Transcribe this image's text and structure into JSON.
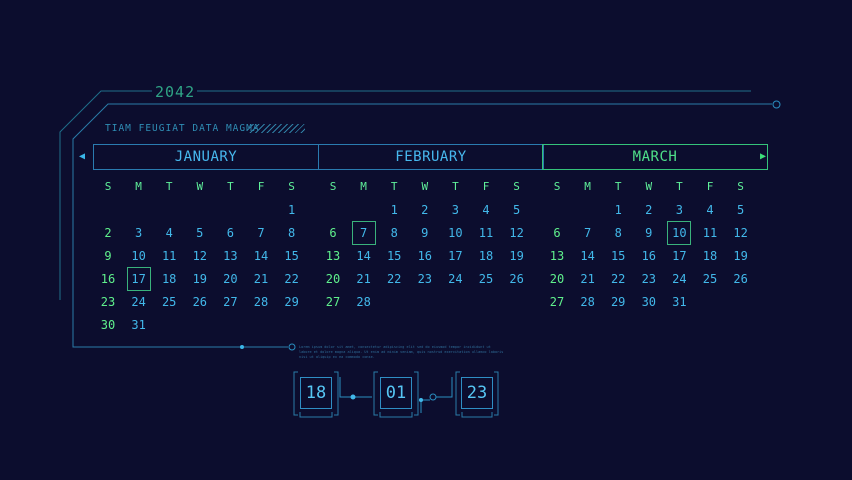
{
  "header": {
    "year": "2042",
    "subtitle": "TIAM FEUGIAT DATA MAGMA"
  },
  "nav": {
    "prev_icon": "◀",
    "next_icon": "▶"
  },
  "weekdays": [
    "S",
    "M",
    "T",
    "W",
    "T",
    "F",
    "S"
  ],
  "months": [
    {
      "name": "JANUARY",
      "offset": 6,
      "days": 31,
      "selected": 17,
      "style": "blue"
    },
    {
      "name": "FEBRUARY",
      "offset": 2,
      "days": 28,
      "selected": 7,
      "style": "blue"
    },
    {
      "name": "MARCH",
      "offset": 2,
      "days": 31,
      "selected": 10,
      "style": "green"
    }
  ],
  "lorem_text": "Lorem ipsum dolor sit amet, consectetur adipiscing elit sed do eiusmod tempor incididunt ut labore et dolore magna aliqua. Ut enim ad minim veniam, quis nostrud exercitation ullamco laboris nisi ut aliquip ex ea commodo conse.",
  "time": {
    "hours": "18",
    "minutes": "01",
    "seconds": "23"
  },
  "colors": {
    "background": "#0c0d2e",
    "accent_blue": "#42b8ea",
    "accent_green": "#5ff08c"
  }
}
